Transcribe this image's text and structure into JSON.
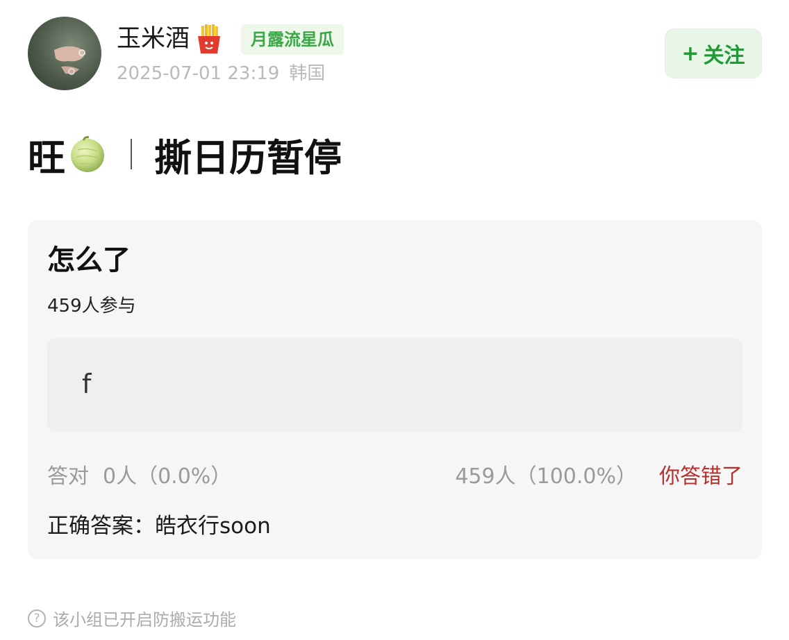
{
  "author": {
    "name": "玉米酒",
    "badge_icon": "fries-emoji-icon",
    "group_badge": "月露流星瓜",
    "timestamp": "2025-07-01 23:19",
    "location": "韩国"
  },
  "follow_button": {
    "plus": "+",
    "label": "关注"
  },
  "post": {
    "title_prefix": "旺",
    "title_emoji": "melon-icon",
    "title_main": "撕日历暂停"
  },
  "quiz": {
    "question": "怎么了",
    "participants": "459人参与",
    "option": "f",
    "correct_label": "答对",
    "correct_count": "0人（0.0%）",
    "selected_count": "459人（100.0%）",
    "result": "你答错了",
    "answer": "正确答案：皓衣行soon"
  },
  "footer": {
    "note": "该小组已开启防搬运功能"
  },
  "colors": {
    "accent_green": "#1f9a37",
    "badge_green": "#3aa845",
    "error_red": "#b8302b",
    "card_bg": "#f6f6f6"
  }
}
